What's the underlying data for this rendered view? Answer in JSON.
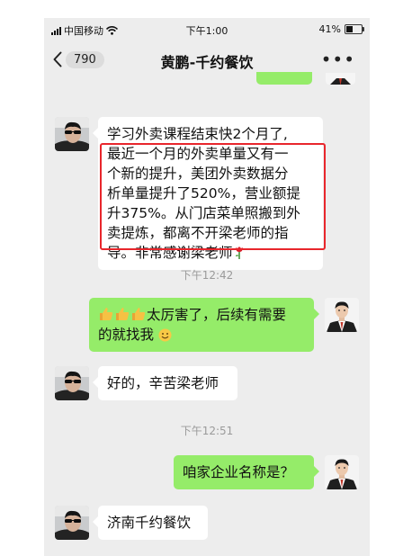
{
  "status_bar": {
    "carrier": "中国移动",
    "time": "下午1:00",
    "battery": "41%",
    "battery_level": 0.41
  },
  "nav": {
    "unread_count": "790",
    "title": "黄鹏-千约餐饮",
    "more": "•••"
  },
  "messages": [
    {
      "side": "left",
      "lines": [
        "学习外卖课程结束快2个月了,",
        "最近一个月的外卖单量又有一",
        "个新的提升，美团外卖数据分",
        "析单量提升了520%，营业额提",
        "升375%。从门店菜单照搬到外",
        "卖提炼，都离不开梁老师的指",
        "导。非常感谢梁老师"
      ]
    },
    {
      "timestamp": "下午12:42"
    },
    {
      "side": "right",
      "lines": [
        "太厉害了，后续有需要",
        "的就找我"
      ]
    },
    {
      "side": "left",
      "text": "好的，辛苦梁老师"
    },
    {
      "timestamp": "下午12:51"
    },
    {
      "side": "right",
      "text": "咱家企业名称是？"
    },
    {
      "side": "left",
      "text": "济南千约餐饮"
    }
  ],
  "colors": {
    "chat_bg": "#ededed",
    "sent_bubble": "#95ec69",
    "received_bubble": "#ffffff",
    "highlight_box": "#e8262c"
  },
  "icons": {
    "signal": "cell-signal-icon",
    "wifi": "wifi-icon",
    "battery": "battery-icon",
    "back": "chevron-left-icon",
    "rose": "rose-emoji-icon",
    "thumbs_up": "thumbs-up-emoji-icon",
    "smile": "smile-emoji-icon"
  }
}
